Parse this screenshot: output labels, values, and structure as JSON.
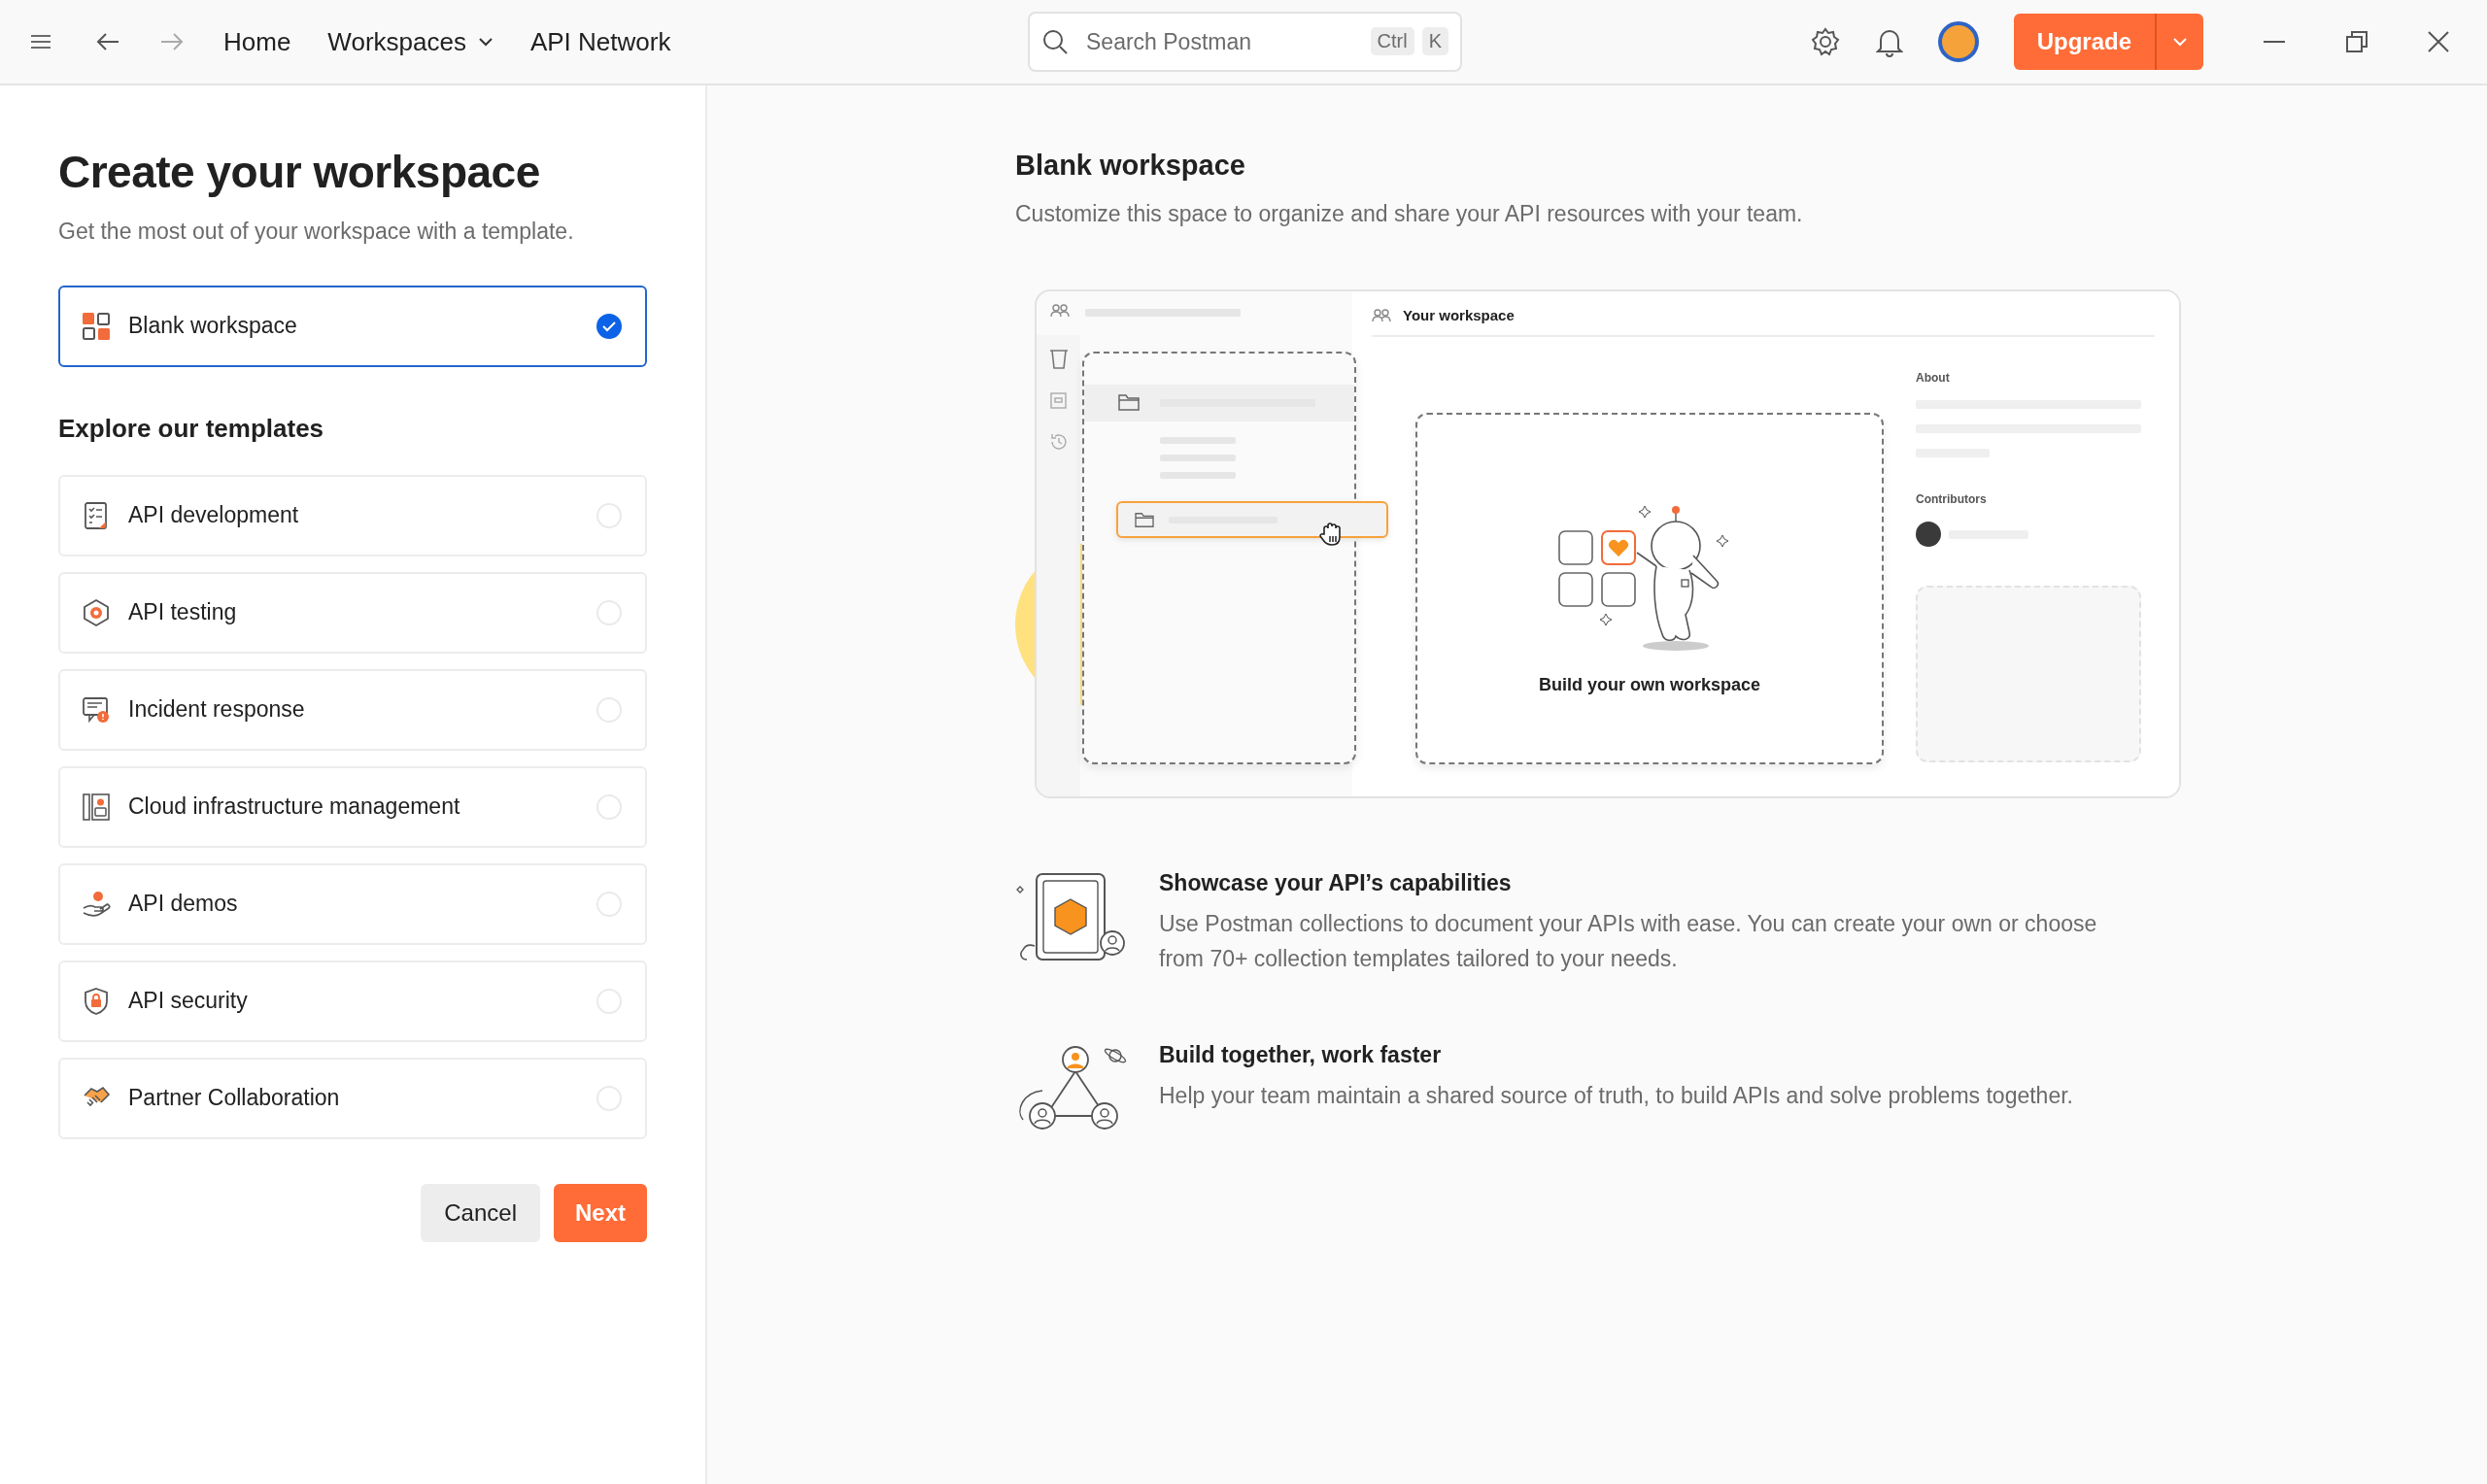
{
  "topbar": {
    "nav": [
      {
        "label": "Home",
        "dropdown": false
      },
      {
        "label": "Workspaces",
        "dropdown": true
      },
      {
        "label": "API Network",
        "dropdown": false
      }
    ],
    "search": {
      "placeholder": "Search Postman",
      "keys": [
        "Ctrl",
        "K"
      ]
    },
    "upgrade": "Upgrade"
  },
  "create": {
    "title": "Create your workspace",
    "subtitle": "Get the most out of your workspace with a template.",
    "blank": {
      "label": "Blank workspace",
      "selected": true
    },
    "templates_title": "Explore our templates",
    "templates": [
      {
        "label": "API development",
        "selected": false
      },
      {
        "label": "API testing",
        "selected": false
      },
      {
        "label": "Incident response",
        "selected": false
      },
      {
        "label": "Cloud infrastructure management",
        "selected": false
      },
      {
        "label": "API demos",
        "selected": false
      },
      {
        "label": "API security",
        "selected": false
      },
      {
        "label": "Partner Collaboration",
        "selected": false
      }
    ],
    "buttons": {
      "cancel": "Cancel",
      "next": "Next"
    }
  },
  "preview": {
    "title": "Blank workspace",
    "description": "Customize this space to organize and share your API resources with your team.",
    "illustration": {
      "header": "Your workspace",
      "caption": "Build your own workspace",
      "about": "About",
      "contributors": "Contributors"
    },
    "features": [
      {
        "title": "Showcase your API’s capabilities",
        "description": "Use Postman collections to document your APIs with ease. You can create your own or choose from 70+ collection templates tailored to your needs."
      },
      {
        "title": "Build together, work faster",
        "description": "Help your team maintain a shared source of truth, to build APIs and solve problems together."
      }
    ]
  }
}
